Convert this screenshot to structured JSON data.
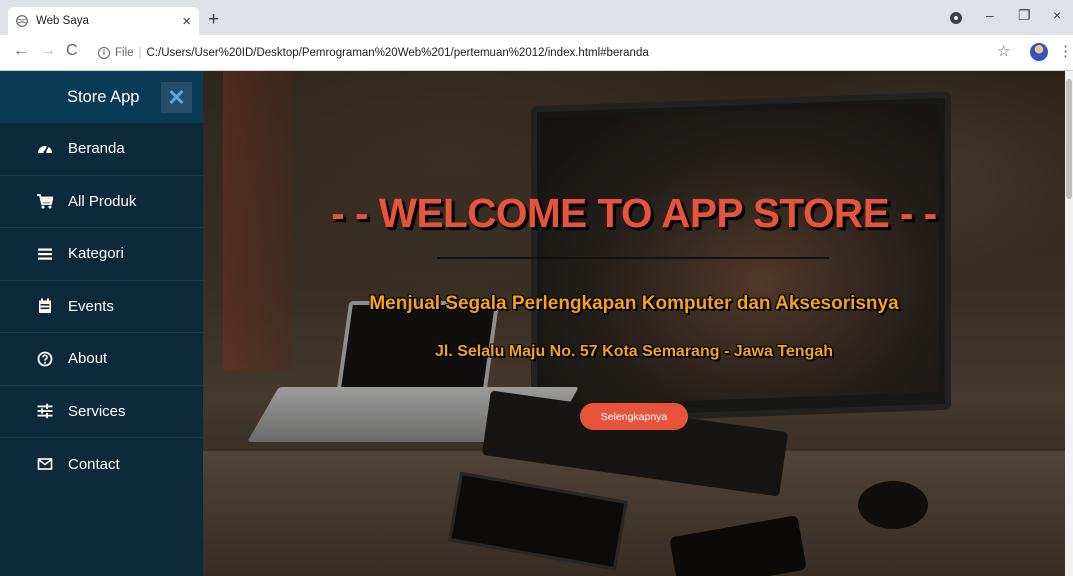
{
  "browser": {
    "tab_title": "Web Saya",
    "tab_close": "×",
    "new_tab": "+",
    "url_scheme": "File",
    "url_path": "C:/Users/User%20ID/Desktop/Pemrograman%20Web%201/pertemuan%2012/index.html#beranda",
    "window_controls": {
      "minimize": "–",
      "restore": "❐",
      "close": "×"
    }
  },
  "sidebar": {
    "brand": "Store App",
    "close_symbol": "✕",
    "items": [
      {
        "label": "Beranda",
        "icon": "dashboard-icon"
      },
      {
        "label": "All Produk",
        "icon": "cart-icon"
      },
      {
        "label": "Kategori",
        "icon": "menu-lines-icon"
      },
      {
        "label": "Events",
        "icon": "calendar-icon"
      },
      {
        "label": "About",
        "icon": "help-circle-icon"
      },
      {
        "label": "Services",
        "icon": "sliders-icon"
      },
      {
        "label": "Contact",
        "icon": "mail-icon"
      }
    ]
  },
  "hero": {
    "title": "- - WELCOME TO APP STORE - -",
    "subtitle": "Menjual Segala Perlengkapan Komputer dan Aksesorisnya",
    "address": "Jl. Selalu Maju No. 57 Kota Semarang - Jawa Tengah",
    "button": "Selengkapnya"
  },
  "colors": {
    "sidebar_bg": "#0d2a3a",
    "sidebar_header": "#0a3b55",
    "accent": "#e8533c",
    "subtitle": "#f6a317"
  }
}
